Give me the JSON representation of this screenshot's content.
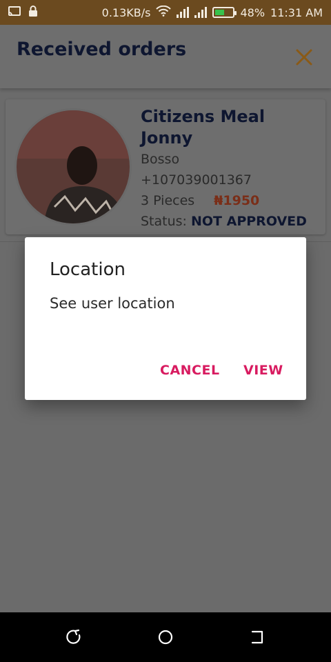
{
  "status_bar": {
    "speed": "0.13KB/s",
    "battery": "48%",
    "time": "11:31 AM",
    "icons": [
      "cast-icon",
      "lock-icon",
      "wifi-icon",
      "signal-icon",
      "battery-icon"
    ]
  },
  "header": {
    "title": "Received orders",
    "close_icon": "close-icon",
    "accent_color": "#c07a16"
  },
  "order": {
    "name_line1": "Citizens Meal",
    "name_line2": "Jonny",
    "location": "Bosso",
    "phone": "+107039001367",
    "pieces": "3 Pieces",
    "price": "₦1950",
    "status_label": "Status:",
    "status_value": "NOT APPROVED"
  },
  "dialog": {
    "title": "Location",
    "message": "See user location",
    "cancel_label": "CANCEL",
    "view_label": "VIEW",
    "button_color": "#d81b60"
  },
  "nav_bar": {
    "icons": [
      "back-icon",
      "home-icon",
      "recent-apps-icon"
    ]
  }
}
